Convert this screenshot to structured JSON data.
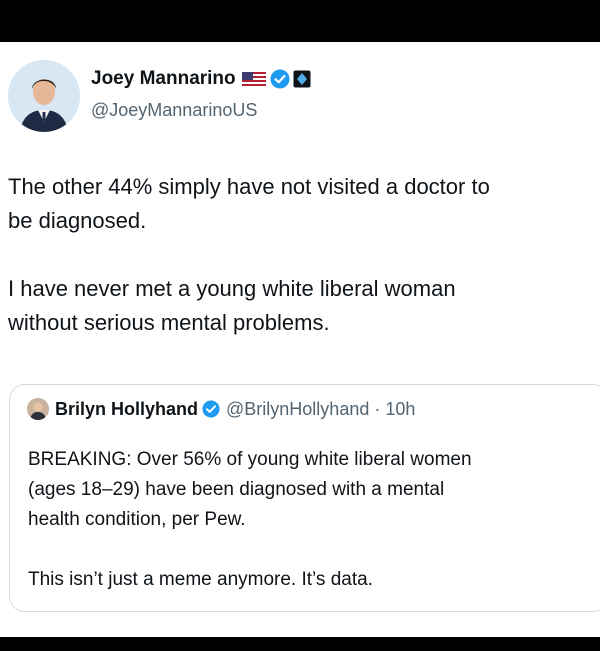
{
  "author": {
    "name": "Joey Mannarino",
    "handle": "@JoeyMannarinoUS",
    "icons": [
      "us-flag-icon",
      "verified-badge-icon",
      "affiliation-badge-icon"
    ]
  },
  "tweet": {
    "paragraphs": [
      "The other 44% simply have not visited a doctor to",
      "be diagnosed.",
      "",
      "I have never met a young white liberal woman",
      "without serious mental problems."
    ]
  },
  "quote": {
    "name": "Brilyn Hollyhand",
    "handle_time": "@BrilynHollyhand · 10h",
    "lines": [
      "BREAKING: Over 56% of young white liberal women",
      "(ages 18–29) have been diagnosed with a mental",
      "health condition, per Pew.",
      "",
      "This isn’t just a meme anymore. It’s data."
    ]
  },
  "colors": {
    "verified_blue": "#1d9bf0",
    "text": "#0f1419",
    "muted": "#536471"
  }
}
